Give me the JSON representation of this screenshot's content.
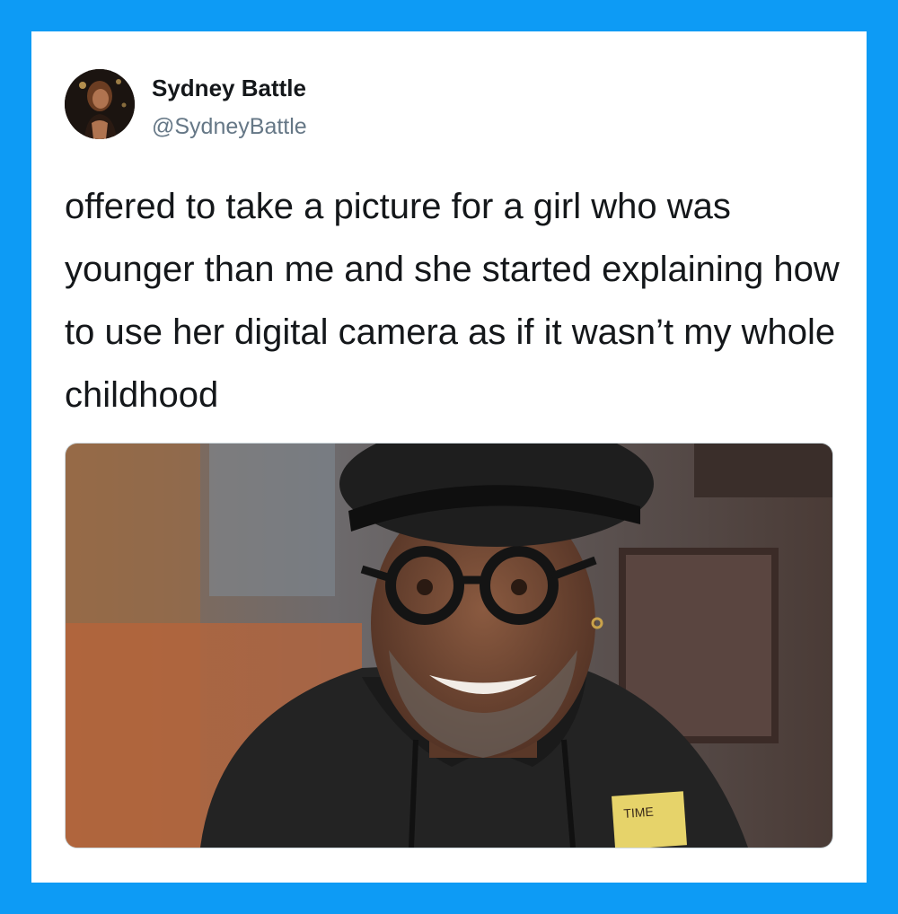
{
  "tweet": {
    "author_name": "Sydney Battle",
    "handle": "@SydneyBattle",
    "text": "offered to take a picture for a girl who was younger than me and she started explaining how to use her digital camera as if it wasn’t my whole childhood"
  },
  "media": {
    "description_icon": "photo-of-man-in-beret-and-round-glasses",
    "hoodie_patch_text": "TIME"
  },
  "colors": {
    "frame": "#0d9bf5",
    "card": "#ffffff",
    "name": "#14171a",
    "handle": "#657786"
  }
}
